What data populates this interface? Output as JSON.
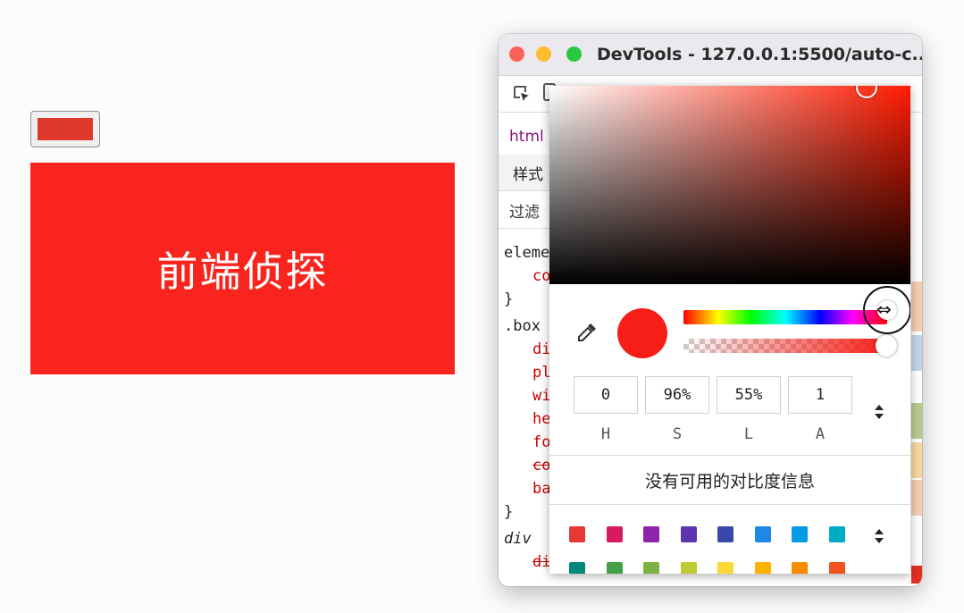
{
  "page": {
    "box_text": "前端侦探"
  },
  "devtools": {
    "window_title": "DevTools - 127.0.0.1:5500/auto-c...",
    "breadcrumb": "html",
    "styles_tab": "样式",
    "filter_label": "过滤",
    "code_lines": [
      {
        "text": "eleme",
        "kind": "sel"
      },
      {
        "text": "co",
        "kind": "prop"
      },
      {
        "text": "}",
        "kind": "sel"
      },
      {
        "text": ".box",
        "kind": "sel"
      },
      {
        "text": "di",
        "kind": "prop"
      },
      {
        "text": "pl",
        "kind": "prop"
      },
      {
        "text": "wi",
        "kind": "prop"
      },
      {
        "text": "he",
        "kind": "prop"
      },
      {
        "text": "fo",
        "kind": "prop"
      },
      {
        "text": "co",
        "kind": "prop-struck"
      },
      {
        "text": "ba",
        "kind": "prop"
      },
      {
        "text": "}",
        "kind": "sel"
      },
      {
        "text": "div",
        "kind": "italic"
      },
      {
        "text": "dis",
        "kind": "prop-struck"
      }
    ]
  },
  "color_picker": {
    "current_color": "#f61f17",
    "hsla": {
      "h_value": "0",
      "s_value": "96%",
      "l_value": "55%",
      "a_value": "1",
      "h_label": "H",
      "s_label": "S",
      "l_label": "L",
      "a_label": "A"
    },
    "contrast_info": "没有可用的对比度信息",
    "palette_row1": [
      "#e53935",
      "#d81b60",
      "#8e24aa",
      "#5e35b1",
      "#3949ab",
      "#1e88e5",
      "#039be5",
      "#00acc1"
    ],
    "palette_row2": [
      "#00897b",
      "#43a047",
      "#7cb342",
      "#c0ca33",
      "#fdd835",
      "#ffb300",
      "#fb8c00",
      "#f4511e"
    ]
  }
}
